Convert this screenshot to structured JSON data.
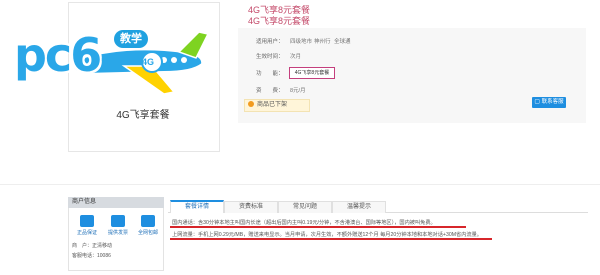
{
  "product": {
    "title": "4G飞享8元套餐",
    "subtitle": "4G飞享8元套餐",
    "image_caption": "4G飞享套餐"
  },
  "logo": {
    "text": "pc6",
    "badge": "教学",
    "badge_small": "4G"
  },
  "info": {
    "rows": [
      {
        "label": "适用用户：",
        "values": [
          "四级地市",
          "神州行",
          "全球通"
        ]
      },
      {
        "label": "生效时间：",
        "values": [
          "次月"
        ]
      },
      {
        "label": "功　　能：",
        "values": [
          "4G飞享8元套餐"
        ]
      },
      {
        "label": "资　　费：",
        "values": [
          "8元/月"
        ]
      }
    ],
    "soldout_text": "商品已下架",
    "cs_button": "联系客服"
  },
  "merchant": {
    "header": "商户信息",
    "services": [
      "正品保证",
      "提供发票",
      "全网包邮"
    ],
    "lines": [
      "商　户：正清移动",
      "客服电话：10086"
    ]
  },
  "tabs": {
    "items": [
      "套餐详情",
      "资费标准",
      "常见问题",
      "温馨提示"
    ],
    "active": 0
  },
  "detail": {
    "line1": "国内通话：含30分钟本地主叫国内长途（超出后国内主叫0.19元/分钟，不含港澳台、国际等地区），国内被叫免费。",
    "line2": "上网流量：手机上网0.29元/MB，赠送来电显示。当月申请，次月生效，不额外赠送12个月  每月20分钟本地和本地对话+30M省内流量。"
  },
  "colors": {
    "accent": "#1e8ee0",
    "price_pink": "#c44a6a",
    "highlight_red": "#d7262b"
  }
}
